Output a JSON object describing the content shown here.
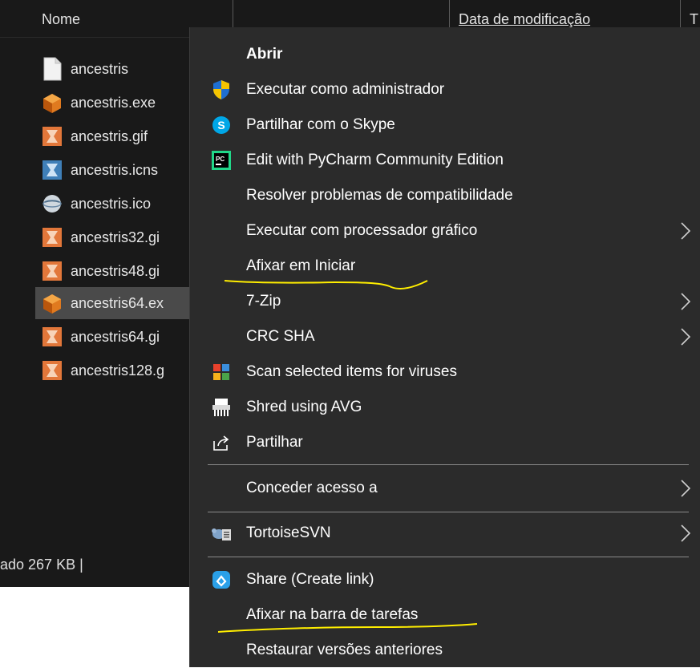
{
  "header": {
    "name_column": "Nome",
    "date_column": "Data de modificação",
    "extra_column": "T"
  },
  "files": [
    {
      "name": "ancestris",
      "icon": "blank-file-icon"
    },
    {
      "name": "ancestris.exe",
      "icon": "ancestris-exe-icon"
    },
    {
      "name": "ancestris.gif",
      "icon": "ancestris-image-icon"
    },
    {
      "name": "ancestris.icns",
      "icon": "ancestris-icns-icon"
    },
    {
      "name": "ancestris.ico",
      "icon": "globe-icon"
    },
    {
      "name": "ancestris32.gi",
      "icon": "ancestris-image-icon"
    },
    {
      "name": "ancestris48.gi",
      "icon": "ancestris-image-icon"
    },
    {
      "name": "ancestris64.ex",
      "icon": "ancestris-exe-icon",
      "selected": true
    },
    {
      "name": "ancestris64.gi",
      "icon": "ancestris-image-icon"
    },
    {
      "name": "ancestris128.g",
      "icon": "ancestris-image-icon"
    }
  ],
  "status_bar": {
    "text": "ado 267 KB   |"
  },
  "context_menu": {
    "items": [
      {
        "label": "Abrir",
        "icon": "",
        "bold": true
      },
      {
        "label": "Executar como administrador",
        "icon": "uac-shield-icon"
      },
      {
        "label": "Partilhar com o Skype",
        "icon": "skype-icon"
      },
      {
        "label": "Edit with PyCharm Community Edition",
        "icon": "pycharm-icon"
      },
      {
        "label": "Resolver problemas de compatibilidade",
        "icon": ""
      },
      {
        "label": "Executar com processador gráfico",
        "icon": "",
        "submenu": true
      },
      {
        "label": "Afixar em Iniciar",
        "icon": ""
      },
      {
        "label": "7-Zip",
        "icon": "",
        "submenu": true
      },
      {
        "label": "CRC SHA",
        "icon": "",
        "submenu": true
      },
      {
        "label": "Scan selected items for viruses",
        "icon": "avg-scan-icon"
      },
      {
        "label": "Shred using AVG",
        "icon": "shredder-icon"
      },
      {
        "label": "Partilhar",
        "icon": "share-icon"
      },
      {
        "label": "Conceder acesso a",
        "icon": "",
        "submenu": true
      },
      {
        "label": "TortoiseSVN",
        "icon": "tortoisesvn-icon",
        "submenu": true
      },
      {
        "label": "Share (Create link)",
        "icon": "onedrive-share-icon"
      },
      {
        "label": "Afixar na barra de tarefas",
        "icon": ""
      },
      {
        "label": "Restaurar versões anteriores",
        "icon": ""
      }
    ]
  },
  "colors": {
    "explorer_bg": "#191919",
    "menu_bg": "#2b2b2b",
    "selection": "#4a4a4a",
    "annotation": "#ffee00"
  }
}
